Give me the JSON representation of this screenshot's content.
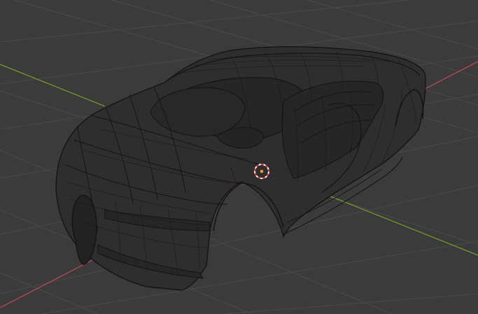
{
  "viewport": {
    "background": "#3b3b3b",
    "grid_color": "#4a4a4a",
    "x_axis_color": "#b54a4f",
    "y_axis_color": "#6f9a2e",
    "wire_color": "#141414",
    "shade_color": "#2e2e2e",
    "cursor_colors": [
      "#e23b3b",
      "#ffffff"
    ],
    "origin_color": "#f0a030"
  },
  "object": {
    "icon": "car-wireframe-mesh",
    "display_mode": "wireframe"
  },
  "scene_elements": {
    "3d_cursor_icon": "crosshair-target-icon",
    "origin_icon": "object-origin-dot-icon"
  }
}
